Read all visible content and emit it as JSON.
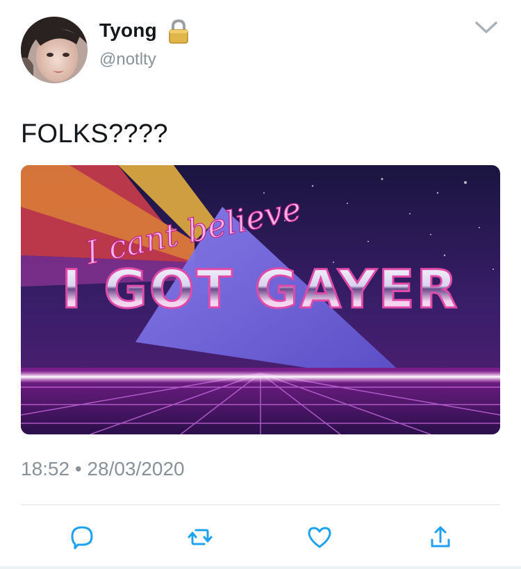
{
  "tweet": {
    "author": {
      "display_name": "Tyong",
      "handle": "@notlty",
      "protected_icon": "lock-icon",
      "avatar_icon": "avatar-photo"
    },
    "menu_icon": "chevron-down-icon",
    "text": "FOLKS????",
    "media": {
      "script_line": "I cant believe",
      "headline": "I GOT GAYER"
    },
    "time": "18:52",
    "separator": "•",
    "date": "28/03/2020"
  },
  "actions": [
    {
      "name": "reply",
      "icon": "reply-icon"
    },
    {
      "name": "retweet",
      "icon": "retweet-icon"
    },
    {
      "name": "like",
      "icon": "heart-icon"
    },
    {
      "name": "share",
      "icon": "share-icon"
    }
  ],
  "colors": {
    "text": "#14171a",
    "muted": "#8a9299",
    "icon": "#1da1f2",
    "divider": "#dfe3e6"
  }
}
